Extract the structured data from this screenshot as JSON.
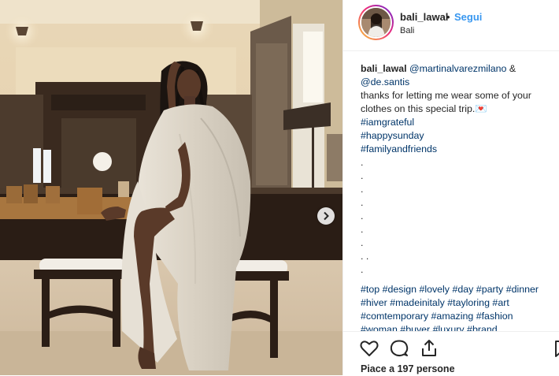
{
  "header": {
    "username": "bali_lawal",
    "separator": "•",
    "follow_label": "Segui",
    "location": "Bali"
  },
  "caption": {
    "username": "bali_lawal",
    "mention_1": "@martinalvarezmilano",
    "amp": " &",
    "mention_2": "@de.santis",
    "text_1": "thanks for letting me wear some of your",
    "text_2": "clothes on this special trip.",
    "emoji": "💌",
    "hashtags_top": [
      "#iamgrateful",
      "#happysunday",
      "#familyandfriends"
    ],
    "dots": [
      ".",
      ".",
      ".",
      ".",
      ".",
      ".",
      ".",
      ". .",
      "."
    ],
    "tag_lines": [
      [
        "#top",
        "#design",
        "#lovely",
        "#day",
        "#party",
        "#dinner"
      ],
      [
        "#hiver",
        "#madeinitaly",
        "#tayloring",
        "#art"
      ],
      [
        "#comtemporary",
        "#amazing",
        "#fashion"
      ],
      [
        "#woman",
        "#buyer",
        "#luxury",
        "#brand"
      ]
    ]
  },
  "actions": {
    "icons": [
      "heart-icon",
      "comment-icon",
      "share-icon",
      "bookmark-icon"
    ],
    "likes_text": "Piace a 197 persone"
  },
  "colors": {
    "link": "#003569",
    "follow": "#3897f0",
    "text": "#262626"
  }
}
